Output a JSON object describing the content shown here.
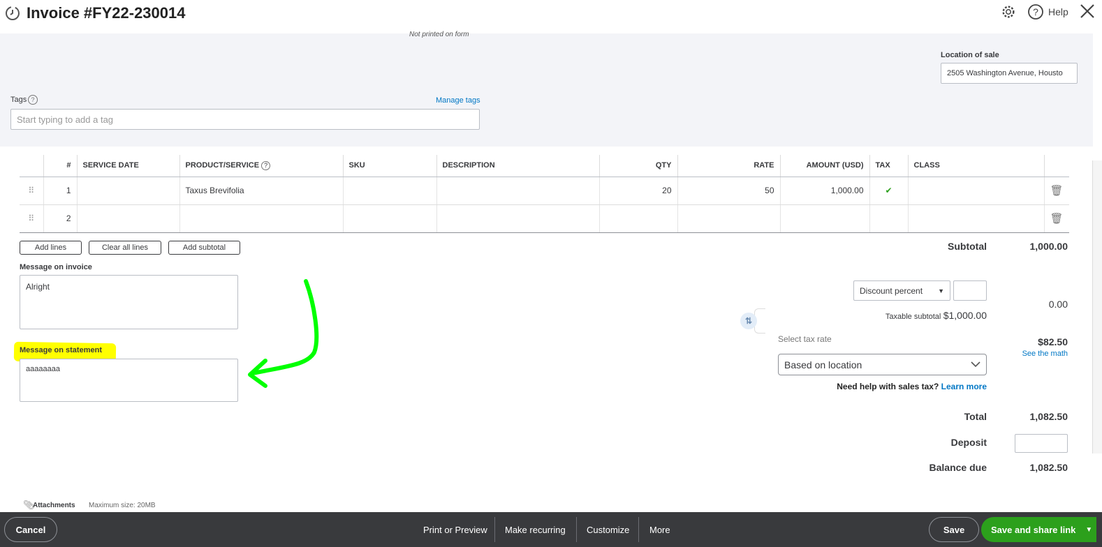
{
  "header": {
    "title": "Invoice #FY22-230014",
    "help": "Help"
  },
  "form": {
    "not_printed": "Not printed on form",
    "location_label": "Location of sale",
    "location_value": "2505 Washington Avenue, Housto",
    "tags_label": "Tags",
    "manage_tags": "Manage tags",
    "tags_placeholder": "Start typing to add a tag"
  },
  "table": {
    "headers": [
      "#",
      "SERVICE DATE",
      "PRODUCT/SERVICE",
      "SKU",
      "DESCRIPTION",
      "QTY",
      "RATE",
      "AMOUNT (USD)",
      "TAX",
      "CLASS"
    ],
    "rows": [
      {
        "num": "1",
        "date": "",
        "product": "Taxus Brevifolia",
        "sku": "",
        "desc": "",
        "qty": "20",
        "rate": "50",
        "amount": "1,000.00",
        "tax": "✔",
        "class": ""
      },
      {
        "num": "2",
        "date": "",
        "product": "",
        "sku": "",
        "desc": "",
        "qty": "",
        "rate": "",
        "amount": "",
        "tax": "",
        "class": ""
      }
    ]
  },
  "buttons": {
    "add_lines": "Add lines",
    "clear_all": "Clear all lines",
    "add_subtotal": "Add subtotal"
  },
  "messages": {
    "invoice_label": "Message on invoice",
    "invoice_value": "Alright",
    "statement_label": "Message on statement",
    "statement_value": "aaaaaaaa"
  },
  "totals": {
    "subtotal_label": "Subtotal",
    "subtotal": "1,000.00",
    "discount_type": "Discount percent",
    "discount_value": "",
    "discount_amount": "0.00",
    "taxable_label": "Taxable subtotal",
    "taxable": "$1,000.00",
    "tax_rate_label": "Select tax rate",
    "tax_rate": "Based on location",
    "tax_amount": "$82.50",
    "see_math": "See the math",
    "help_text": "Need help with sales tax?",
    "learn_more": "Learn more",
    "total_label": "Total",
    "total": "1,082.50",
    "deposit_label": "Deposit",
    "deposit": "",
    "balance_label": "Balance due",
    "balance": "1,082.50"
  },
  "attachments": {
    "label": "Attachments",
    "max": "Maximum size: 20MB"
  },
  "footer": {
    "cancel": "Cancel",
    "print": "Print or Preview",
    "recurring": "Make recurring",
    "customize": "Customize",
    "more": "More",
    "save": "Save",
    "save_share": "Save and share link"
  },
  "colors": {
    "accent": "#2ca01c",
    "link": "#0077c5",
    "footer": "#393a3d",
    "highlight": "#ffff00",
    "arrow": "#00ff00"
  }
}
